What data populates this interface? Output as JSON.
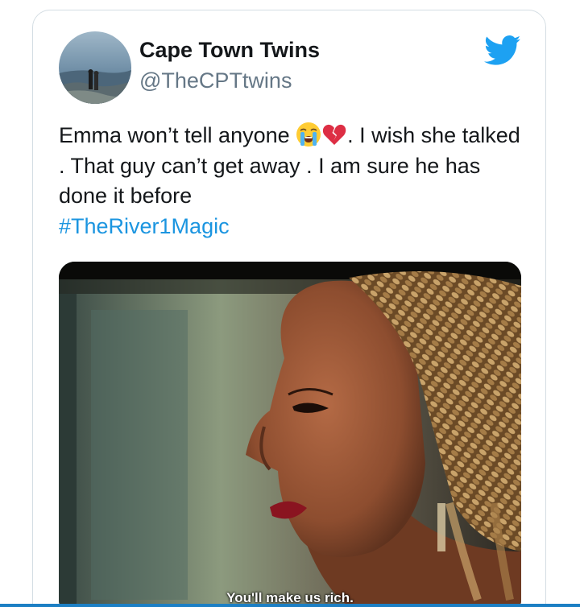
{
  "tweet": {
    "author_name": "Cape Town Twins",
    "author_handle": "@TheCPTtwins",
    "text_part1": "Emma won’t tell anyone ",
    "text_part2": ". I wish she talked . That guy can’t get away . I am sure he has done it before",
    "hashtag": "#TheRiver1Magic",
    "emojis": [
      "loudly-crying-face-icon",
      "broken-heart-icon"
    ]
  },
  "media": {
    "subtitle": "You'll make us rich."
  },
  "colors": {
    "twitter_blue": "#1da1f2",
    "hashtag": "#1b95e0",
    "handle_gray": "#657786",
    "text": "#14171a"
  }
}
